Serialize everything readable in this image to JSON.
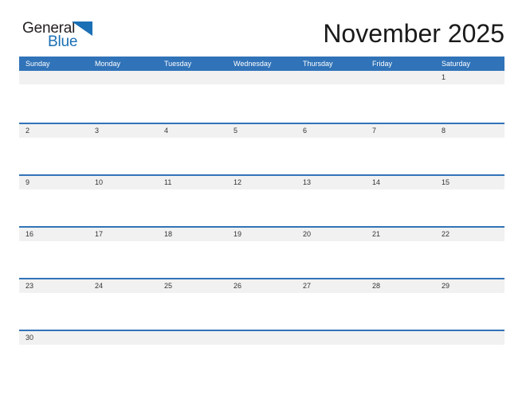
{
  "brand": {
    "name_part1": "General",
    "name_part2": "Blue",
    "triangle_color": "#1a6fb5",
    "text_color": "#231f20",
    "blue_color": "#1a6fb5"
  },
  "header": {
    "title": "November 2025",
    "month": "November",
    "year": "2025"
  },
  "colors": {
    "header_blue": "#3173b8",
    "row_divider_blue": "#3173b8",
    "day_band_gray": "#f1f1f1",
    "page_background": "#ffffff",
    "day_number_text": "#333333",
    "weekday_text": "#ffffff"
  },
  "calendar": {
    "weekdays": [
      "Sunday",
      "Monday",
      "Tuesday",
      "Wednesday",
      "Thursday",
      "Friday",
      "Saturday"
    ],
    "weeks": [
      [
        "",
        "",
        "",
        "",
        "",
        "",
        "1"
      ],
      [
        "2",
        "3",
        "4",
        "5",
        "6",
        "7",
        "8"
      ],
      [
        "9",
        "10",
        "11",
        "12",
        "13",
        "14",
        "15"
      ],
      [
        "16",
        "17",
        "18",
        "19",
        "20",
        "21",
        "22"
      ],
      [
        "23",
        "24",
        "25",
        "26",
        "27",
        "28",
        "29"
      ],
      [
        "30",
        "",
        "",
        "",
        "",
        "",
        ""
      ]
    ]
  }
}
